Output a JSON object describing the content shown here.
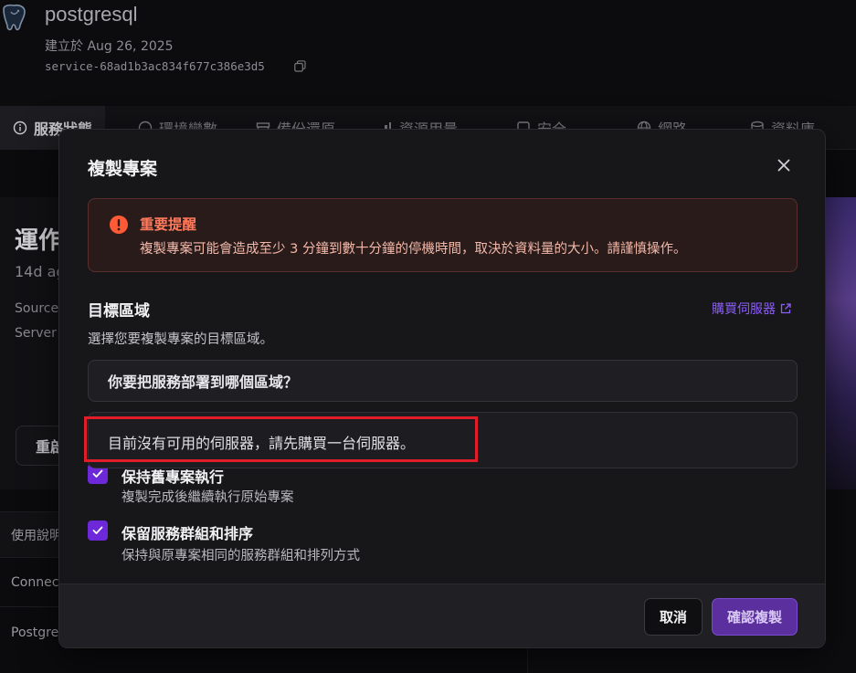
{
  "service": {
    "name": "postgresql",
    "created": "建立於 Aug 26, 2025",
    "id": "service-68ad1b3ac834f677c386e3d5"
  },
  "tabs": [
    {
      "label": "服務狀態",
      "icon": "info-icon",
      "active": true
    },
    {
      "label": "環境變數",
      "icon": "variable-icon",
      "active": false
    },
    {
      "label": "備份還原",
      "icon": "archive-icon",
      "active": false
    },
    {
      "label": "資源用量",
      "icon": "chart-icon",
      "active": false
    },
    {
      "label": "安全",
      "icon": "shield-icon",
      "active": false
    },
    {
      "label": "網路",
      "icon": "globe-icon",
      "active": false
    },
    {
      "label": "資料庫",
      "icon": "database-icon",
      "active": false
    }
  ],
  "background": {
    "status": "運作",
    "ago": "14d ag",
    "source": "Source",
    "server": "Server",
    "restart": "重啟",
    "rows": [
      "使用說明",
      "Connec",
      "Postgre"
    ]
  },
  "modal": {
    "title": "複製專案",
    "alert_title": "重要提醒",
    "alert_body": "複製專案可能會造成至少 3 分鐘到數十分鐘的停機時間，取決於資料量的大小。請謹慎操作。",
    "section_title": "目標區域",
    "buy_link": "購買伺服器",
    "section_desc": "選擇您要複製專案的目標區域。",
    "select_placeholder": "你要把服務部署到哪個區域？",
    "empty_message": "目前沒有可用的伺服器，請先購買一台伺服器。",
    "options": [
      {
        "label": "保持舊專案執行",
        "sub": "複製完成後繼續執行原始專案",
        "checked": true
      },
      {
        "label": "保留服務群組和排序",
        "sub": "保持與原專案相同的服務群組和排列方式",
        "checked": true
      }
    ],
    "cancel": "取消",
    "confirm": "確認複製"
  },
  "colors": {
    "accent": "#6d28d9",
    "link": "#8b5cf6",
    "alert": "#ff7a5c",
    "highlight": "#e11d2a"
  }
}
